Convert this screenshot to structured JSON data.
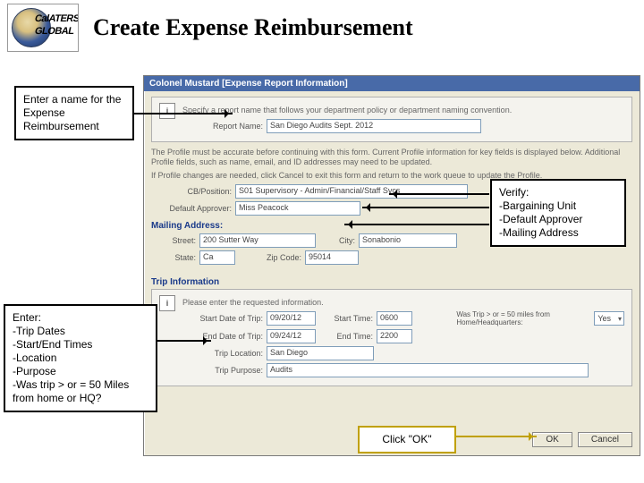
{
  "header": {
    "logo_line1": "CalATERS",
    "logo_line2": "GLOBAL",
    "title": "Create Expense Reimbursement"
  },
  "callouts": {
    "name": "Enter a name for the Expense Reimbursement",
    "verify": {
      "heading": "Verify:",
      "l1": "-Bargaining Unit",
      "l2": "-Default Approver",
      "l3": "-Mailing Address"
    },
    "enter": {
      "heading": "Enter:",
      "l1": "-Trip Dates",
      "l2": "-Start/End Times",
      "l3": "-Location",
      "l4": "-Purpose",
      "l5": "-Was trip > or = 50 Miles from home or HQ?"
    },
    "click_ok": "Click  \"OK\""
  },
  "window": {
    "title": "Colonel Mustard [Expense Report Information]",
    "info_text": "Specify a report name that follows your department policy or department naming convention.",
    "report_name_label": "Report Name:",
    "report_name_value": "San Diego Audits Sept. 2012",
    "profile_p1": "The Profile must be accurate before continuing with this form. Current Profile information for key fields is displayed below. Additional Profile fields, such as name, email, and ID addresses may need to be updated.",
    "profile_p2": "If Profile changes are needed, click Cancel to exit this form and return to the work queue to update the Profile.",
    "cb_label": "CB/Position:",
    "cb_value": "S01 Supervisory - Admin/Financial/Staff Svcs",
    "approver_label": "Default Approver:",
    "approver_value": "Miss Peacock",
    "mailing_heading": "Mailing Address:",
    "street_label": "Street:",
    "street_value": "200 Sutter Way",
    "city_label": "City:",
    "city_value": "Sonabonio",
    "state_label": "State:",
    "state_value": "Ca",
    "zip_label": "Zip Code:",
    "zip_value": "95014",
    "trip_heading": "Trip Information",
    "trip_info_text": "Please enter the requested information.",
    "startdate_label": "Start Date of Trip:",
    "startdate_value": "09/20/12",
    "starttime_label": "Start Time:",
    "starttime_value": "0600",
    "enddate_label": "End Date of Trip:",
    "enddate_value": "09/24/12",
    "endtime_label": "End Time:",
    "endtime_value": "2200",
    "triploc_label": "Trip Location:",
    "triploc_value": "San Diego",
    "trippurpose_label": "Trip Purpose:",
    "trippurpose_value": "Audits",
    "miles_label": "Was Trip > or = 50 miles from Home/Headquarters:",
    "miles_value": "Yes",
    "ok": "OK",
    "cancel": "Cancel"
  }
}
